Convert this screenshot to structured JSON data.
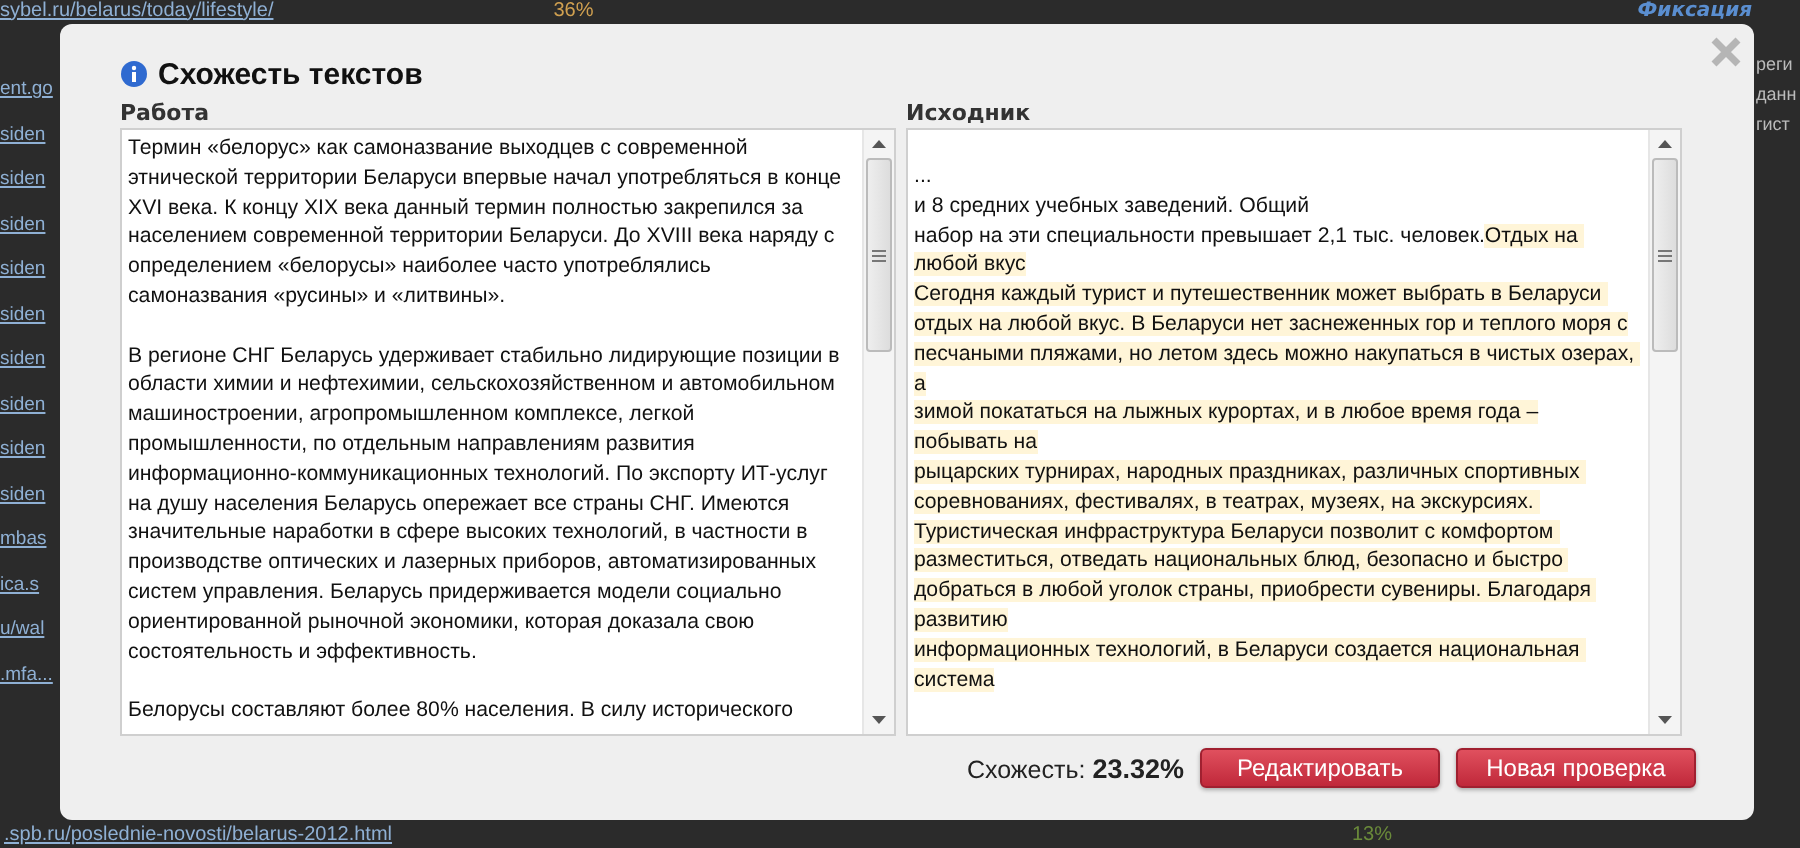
{
  "background": {
    "top_link": "sybel.ru/belarus/today/lifestyle/",
    "top_percent": "36%",
    "brand": "Фиксация",
    "side_links": [
      "ent.go",
      "siden",
      "siden",
      "siden",
      "siden",
      "siden",
      "siden",
      "siden",
      "siden",
      "siden",
      "mbas",
      "ica.s",
      "u/wal",
      ".mfa..."
    ],
    "right_fragments": [
      "реги",
      "данн",
      "гист"
    ],
    "bottom_link": ".spb.ru/poslednie-novosti/belarus-2012.html",
    "bottom_percent": "13%"
  },
  "dialog": {
    "title": "Схожесть текстов",
    "work": {
      "label": "Работа",
      "paragraphs": [
        "Термин «белорус» как самоназвание выходцев с современной этнической территории Беларуси впервые начал употребляться в конце XVI века. К концу XIX века данный термин полностью закрепился за населением современной территории Беларуси. До XVIII века наряду с определением «белорусы» наиболее часто употреблялись самоназвания «русины» и «литвины».",
        "В регионе СНГ Беларусь удерживает стабильно лидирующие позиции в области химии и нефтехимии, сельскохозяйственном и автомобильном машиностроении, агропромышленном комплексе, легкой промышленности, по отдельным направлениям развития информационно-коммуникационных технологий. По экспорту ИТ-услуг на душу населения Беларусь опережает все страны СНГ. Имеются значительные наработки в сфере высоких технологий, в частности в производстве оптических и лазерных приборов, автоматизированных систем управления. Беларусь придерживается модели социально ориентированной рыночной экономики, которая доказала свою состоятельность и эффективность.",
        "Белорусы составляют более 80% населения. В силу исторического"
      ]
    },
    "source": {
      "label": "Исходник",
      "segments": [
        {
          "text": "...\nи 8 средних учебных заведений. Общий\nнабор на эти специальности превышает 2,1 тыс. человек.",
          "match": false
        },
        {
          "text": "Отдых на любой вкус\nСегодня каждый турист и путешественник может выбрать в Беларуси отдых на любой вкус. В Беларуси нет заснеженных гор и теплого моря с\nпесчаными пляжами, но летом здесь можно накупаться в чистых озерах, а\nзимой покататься на лыжных курортах, и в любое время года –\nпобывать на\nрыцарских турнирах, народных праздниках, различных спортивных соревнованиях, фестивалях, в театрах, музеях, на экскурсиях. Туристическая инфраструктура Беларуси позволит с комфортом разместиться, отведать национальных блюд, безопасно и быстро добраться в любой уголок страны, приобрести сувениры. Благодаря развитию\nинформационных технологий, в Беларуси создается национальная система",
          "match": true
        }
      ]
    },
    "similarity_label": "Схожесть:",
    "similarity_value": "23.32%",
    "buttons": [
      "Редактировать",
      "Новая проверка"
    ]
  }
}
